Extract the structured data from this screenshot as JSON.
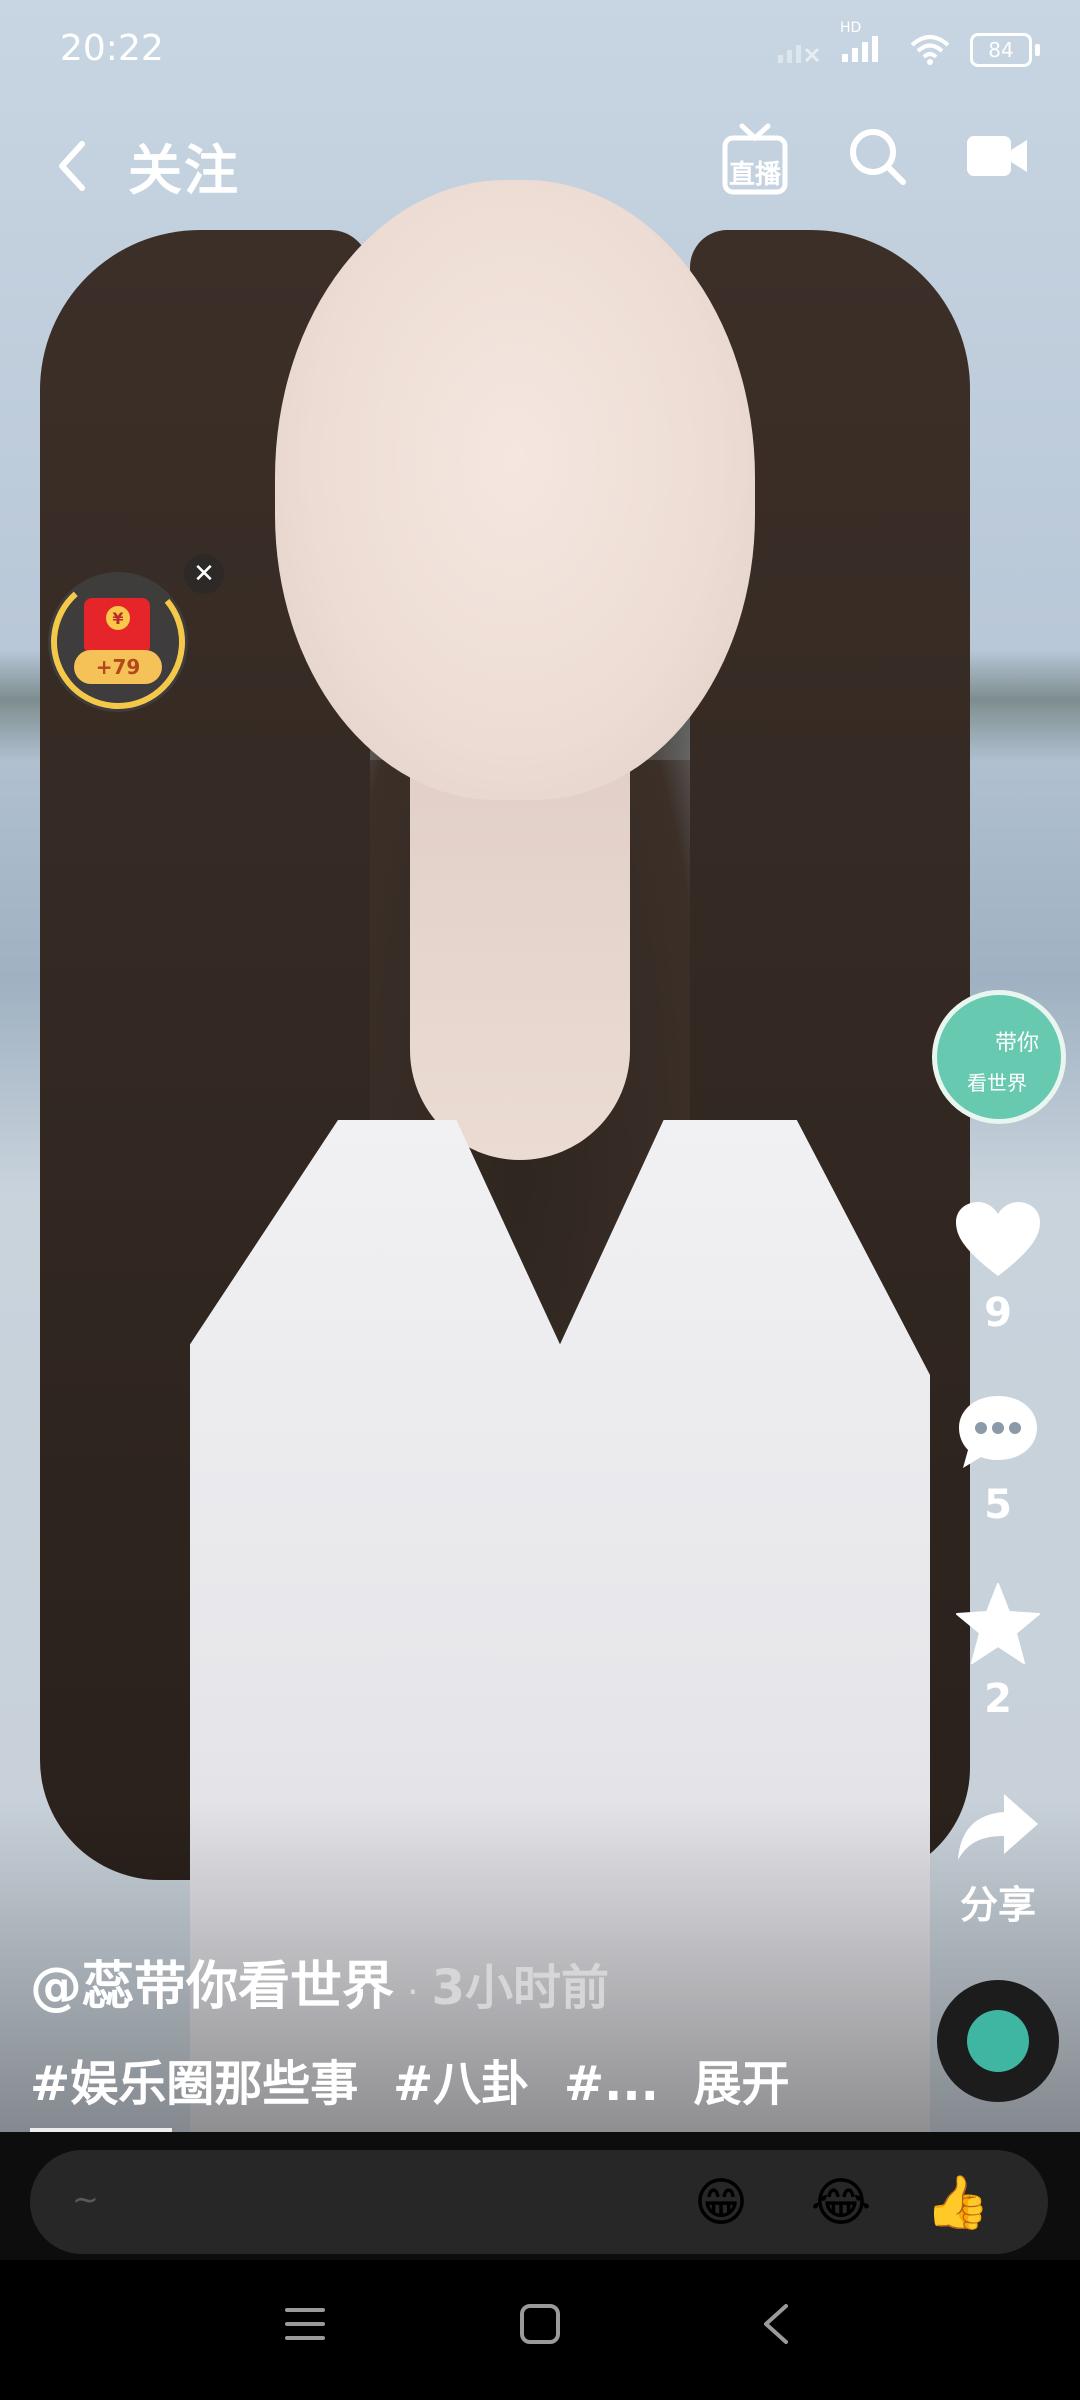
{
  "status_bar": {
    "time": "20:22",
    "network_label": "HD",
    "battery": "84",
    "icons": [
      "signal-weak-icon",
      "signal-icon",
      "wifi-icon",
      "battery-icon"
    ]
  },
  "top_nav": {
    "title": "关注",
    "live_label": "直播",
    "icons": [
      "back-chevron-icon",
      "live-tv-icon",
      "search-icon",
      "video-camera-icon"
    ]
  },
  "red_packet": {
    "amount": "+79",
    "coin_symbol": "¥",
    "close_symbol": "✕"
  },
  "creator": {
    "avatar_text_1": "带你",
    "avatar_text_2": "看世界"
  },
  "actions": {
    "likes": "9",
    "comments": "5",
    "favorites": "2",
    "share_label": "分享"
  },
  "caption": {
    "author": "@蕊带你看世界",
    "separator": "·",
    "time_ago": "3小时前",
    "tags": [
      "#娱乐圈那些事",
      "#八卦",
      "#..."
    ],
    "expand_label": "展开"
  },
  "comment_bar": {
    "placeholder": "~",
    "emojis": [
      "😁",
      "😂",
      "👍"
    ]
  },
  "colors": {
    "accent_yellow": "#f4c94a",
    "red_packet": "#e5252a",
    "avatar_teal": "#66c9b0",
    "comment_bar_bg": "#272727"
  }
}
